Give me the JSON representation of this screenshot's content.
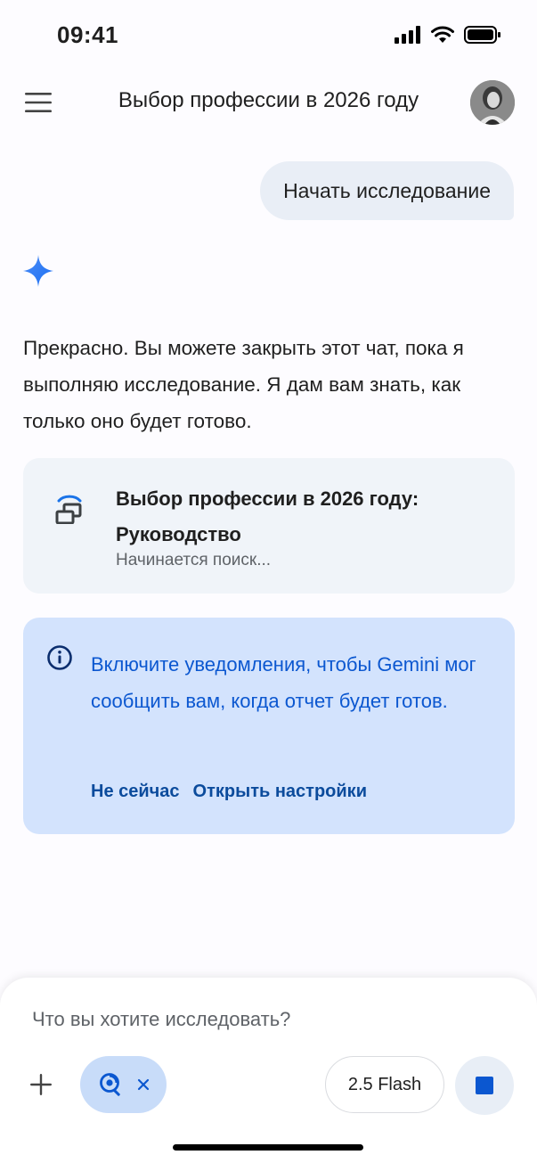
{
  "status_bar": {
    "time": "09:41"
  },
  "header": {
    "title": "Выбор профессии в 2026 году",
    "menu_icon": "hamburger-menu-icon",
    "avatar_icon": "user-avatar"
  },
  "chat": {
    "user_message": "Начать исследование",
    "assistant_icon": "gemini-spark-icon",
    "assistant_message": "Прекрасно. Вы можете закрыть этот чат, пока я выполняю исследование. Я дам вам знать, как только оно будет готово."
  },
  "research_card": {
    "icon": "deep-research-icon",
    "title": "Выбор профессии в 2026 году: Руководство",
    "status": "Начинается поиск..."
  },
  "notification": {
    "icon": "info-icon",
    "text": "Включите уведомления, чтобы Gemini мог сообщить вам, когда отчет будет готов.",
    "dismiss_label": "Не сейчас",
    "settings_label": "Открыть настройки"
  },
  "composer": {
    "placeholder": "Что вы хотите исследовать?",
    "model_label": "2.5 Flash",
    "tool_icon": "deep-research-tool-icon",
    "stop_icon": "stop-icon"
  },
  "colors": {
    "accent": "#0b57d0",
    "notify_bg": "#d3e3fd",
    "card_bg": "#f0f4f9",
    "bubble_bg": "#e9eef6"
  }
}
